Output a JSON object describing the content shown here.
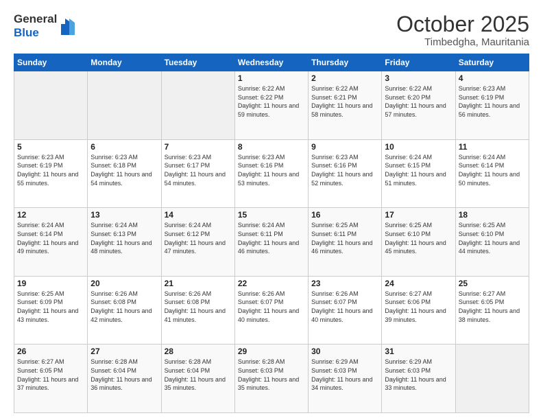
{
  "header": {
    "logo_general": "General",
    "logo_blue": "Blue",
    "title": "October 2025",
    "subtitle": "Timbedgha, Mauritania"
  },
  "weekdays": [
    "Sunday",
    "Monday",
    "Tuesday",
    "Wednesday",
    "Thursday",
    "Friday",
    "Saturday"
  ],
  "weeks": [
    [
      {
        "day": "",
        "sunrise": "",
        "sunset": "",
        "daylight": ""
      },
      {
        "day": "",
        "sunrise": "",
        "sunset": "",
        "daylight": ""
      },
      {
        "day": "",
        "sunrise": "",
        "sunset": "",
        "daylight": ""
      },
      {
        "day": "1",
        "sunrise": "Sunrise: 6:22 AM",
        "sunset": "Sunset: 6:22 PM",
        "daylight": "Daylight: 11 hours and 59 minutes."
      },
      {
        "day": "2",
        "sunrise": "Sunrise: 6:22 AM",
        "sunset": "Sunset: 6:21 PM",
        "daylight": "Daylight: 11 hours and 58 minutes."
      },
      {
        "day": "3",
        "sunrise": "Sunrise: 6:22 AM",
        "sunset": "Sunset: 6:20 PM",
        "daylight": "Daylight: 11 hours and 57 minutes."
      },
      {
        "day": "4",
        "sunrise": "Sunrise: 6:23 AM",
        "sunset": "Sunset: 6:19 PM",
        "daylight": "Daylight: 11 hours and 56 minutes."
      }
    ],
    [
      {
        "day": "5",
        "sunrise": "Sunrise: 6:23 AM",
        "sunset": "Sunset: 6:19 PM",
        "daylight": "Daylight: 11 hours and 55 minutes."
      },
      {
        "day": "6",
        "sunrise": "Sunrise: 6:23 AM",
        "sunset": "Sunset: 6:18 PM",
        "daylight": "Daylight: 11 hours and 54 minutes."
      },
      {
        "day": "7",
        "sunrise": "Sunrise: 6:23 AM",
        "sunset": "Sunset: 6:17 PM",
        "daylight": "Daylight: 11 hours and 54 minutes."
      },
      {
        "day": "8",
        "sunrise": "Sunrise: 6:23 AM",
        "sunset": "Sunset: 6:16 PM",
        "daylight": "Daylight: 11 hours and 53 minutes."
      },
      {
        "day": "9",
        "sunrise": "Sunrise: 6:23 AM",
        "sunset": "Sunset: 6:16 PM",
        "daylight": "Daylight: 11 hours and 52 minutes."
      },
      {
        "day": "10",
        "sunrise": "Sunrise: 6:24 AM",
        "sunset": "Sunset: 6:15 PM",
        "daylight": "Daylight: 11 hours and 51 minutes."
      },
      {
        "day": "11",
        "sunrise": "Sunrise: 6:24 AM",
        "sunset": "Sunset: 6:14 PM",
        "daylight": "Daylight: 11 hours and 50 minutes."
      }
    ],
    [
      {
        "day": "12",
        "sunrise": "Sunrise: 6:24 AM",
        "sunset": "Sunset: 6:14 PM",
        "daylight": "Daylight: 11 hours and 49 minutes."
      },
      {
        "day": "13",
        "sunrise": "Sunrise: 6:24 AM",
        "sunset": "Sunset: 6:13 PM",
        "daylight": "Daylight: 11 hours and 48 minutes."
      },
      {
        "day": "14",
        "sunrise": "Sunrise: 6:24 AM",
        "sunset": "Sunset: 6:12 PM",
        "daylight": "Daylight: 11 hours and 47 minutes."
      },
      {
        "day": "15",
        "sunrise": "Sunrise: 6:24 AM",
        "sunset": "Sunset: 6:11 PM",
        "daylight": "Daylight: 11 hours and 46 minutes."
      },
      {
        "day": "16",
        "sunrise": "Sunrise: 6:25 AM",
        "sunset": "Sunset: 6:11 PM",
        "daylight": "Daylight: 11 hours and 46 minutes."
      },
      {
        "day": "17",
        "sunrise": "Sunrise: 6:25 AM",
        "sunset": "Sunset: 6:10 PM",
        "daylight": "Daylight: 11 hours and 45 minutes."
      },
      {
        "day": "18",
        "sunrise": "Sunrise: 6:25 AM",
        "sunset": "Sunset: 6:10 PM",
        "daylight": "Daylight: 11 hours and 44 minutes."
      }
    ],
    [
      {
        "day": "19",
        "sunrise": "Sunrise: 6:25 AM",
        "sunset": "Sunset: 6:09 PM",
        "daylight": "Daylight: 11 hours and 43 minutes."
      },
      {
        "day": "20",
        "sunrise": "Sunrise: 6:26 AM",
        "sunset": "Sunset: 6:08 PM",
        "daylight": "Daylight: 11 hours and 42 minutes."
      },
      {
        "day": "21",
        "sunrise": "Sunrise: 6:26 AM",
        "sunset": "Sunset: 6:08 PM",
        "daylight": "Daylight: 11 hours and 41 minutes."
      },
      {
        "day": "22",
        "sunrise": "Sunrise: 6:26 AM",
        "sunset": "Sunset: 6:07 PM",
        "daylight": "Daylight: 11 hours and 40 minutes."
      },
      {
        "day": "23",
        "sunrise": "Sunrise: 6:26 AM",
        "sunset": "Sunset: 6:07 PM",
        "daylight": "Daylight: 11 hours and 40 minutes."
      },
      {
        "day": "24",
        "sunrise": "Sunrise: 6:27 AM",
        "sunset": "Sunset: 6:06 PM",
        "daylight": "Daylight: 11 hours and 39 minutes."
      },
      {
        "day": "25",
        "sunrise": "Sunrise: 6:27 AM",
        "sunset": "Sunset: 6:05 PM",
        "daylight": "Daylight: 11 hours and 38 minutes."
      }
    ],
    [
      {
        "day": "26",
        "sunrise": "Sunrise: 6:27 AM",
        "sunset": "Sunset: 6:05 PM",
        "daylight": "Daylight: 11 hours and 37 minutes."
      },
      {
        "day": "27",
        "sunrise": "Sunrise: 6:28 AM",
        "sunset": "Sunset: 6:04 PM",
        "daylight": "Daylight: 11 hours and 36 minutes."
      },
      {
        "day": "28",
        "sunrise": "Sunrise: 6:28 AM",
        "sunset": "Sunset: 6:04 PM",
        "daylight": "Daylight: 11 hours and 35 minutes."
      },
      {
        "day": "29",
        "sunrise": "Sunrise: 6:28 AM",
        "sunset": "Sunset: 6:03 PM",
        "daylight": "Daylight: 11 hours and 35 minutes."
      },
      {
        "day": "30",
        "sunrise": "Sunrise: 6:29 AM",
        "sunset": "Sunset: 6:03 PM",
        "daylight": "Daylight: 11 hours and 34 minutes."
      },
      {
        "day": "31",
        "sunrise": "Sunrise: 6:29 AM",
        "sunset": "Sunset: 6:03 PM",
        "daylight": "Daylight: 11 hours and 33 minutes."
      },
      {
        "day": "",
        "sunrise": "",
        "sunset": "",
        "daylight": ""
      }
    ]
  ]
}
